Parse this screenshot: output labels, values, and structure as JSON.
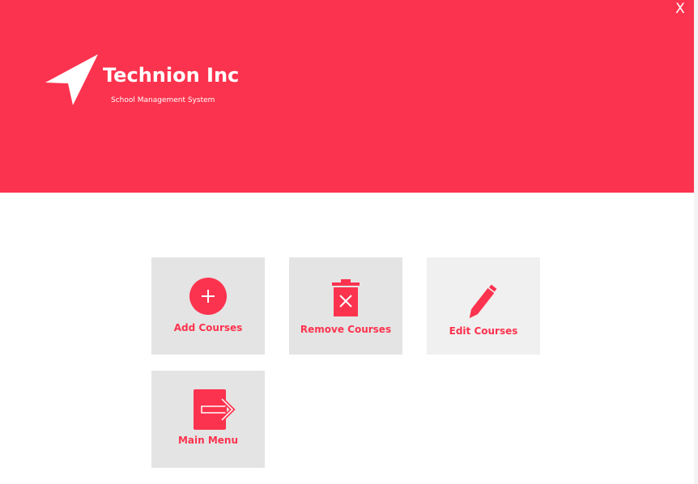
{
  "app": {
    "title": "Technion Inc",
    "subtitle": "School Management System",
    "close_label": "X",
    "logo_icon": "paper-plane-icon"
  },
  "colors": {
    "accent": "#fc334e",
    "tile_background": "#e4e4e4",
    "tile_background_hover": "#f0f0f0",
    "background": "#ffffff"
  },
  "tiles": [
    {
      "label": "Add Courses",
      "icon": "plus-circle-icon"
    },
    {
      "label": "Remove Courses",
      "icon": "trash-icon"
    },
    {
      "label": "Edit Courses",
      "icon": "pencil-icon"
    },
    {
      "label": "Main Menu",
      "icon": "exit-icon"
    }
  ]
}
